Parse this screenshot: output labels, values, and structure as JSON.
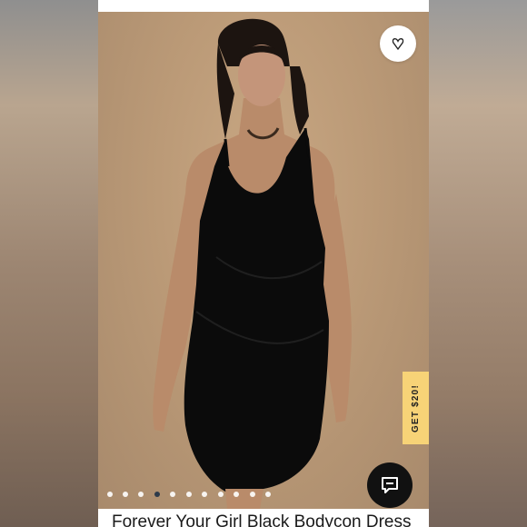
{
  "product": {
    "title": "Forever Your Girl Black Bodycon Dress"
  },
  "overlay": {
    "promo_label": "GET $20!",
    "favorite_icon": "heart-outline-icon",
    "chat_icon": "chat-bubble-icon"
  },
  "carousel": {
    "total_images": 11,
    "active_index": 3
  },
  "colors": {
    "photo_background": "#bb9a77",
    "promo_tab": "#f7d377",
    "chat_button": "#111111",
    "active_dot": "#2d3a4a"
  }
}
